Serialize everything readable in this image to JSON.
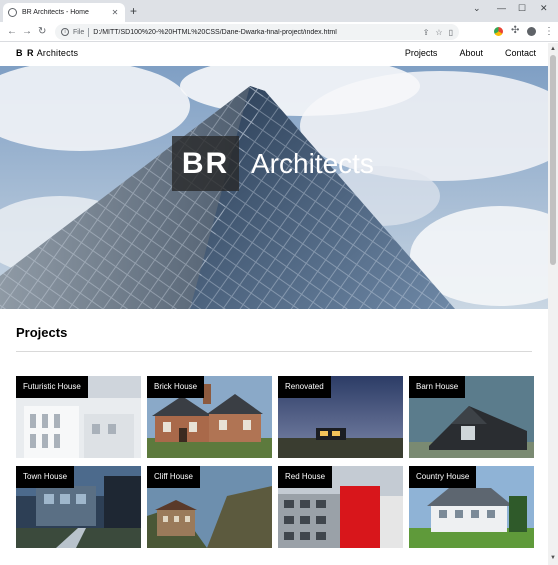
{
  "browser": {
    "tab_title": "BR Architects - Home",
    "scheme": "File",
    "url": "D:/MITT/SD100%20-%20HTML%20CSS/Dane-Dwarka-final-project/index.html"
  },
  "site": {
    "brand_initials": "B R",
    "brand_name": "Architects",
    "nav": [
      "Projects",
      "About",
      "Contact"
    ]
  },
  "hero": {
    "initials": "BR",
    "name": "Architects"
  },
  "projects": {
    "heading": "Projects",
    "items": [
      {
        "label": "Futuristic House"
      },
      {
        "label": "Brick House"
      },
      {
        "label": "Renovated"
      },
      {
        "label": "Barn House"
      },
      {
        "label": "Town House"
      },
      {
        "label": "Cliff House"
      },
      {
        "label": "Red House"
      },
      {
        "label": "Country House"
      }
    ]
  }
}
